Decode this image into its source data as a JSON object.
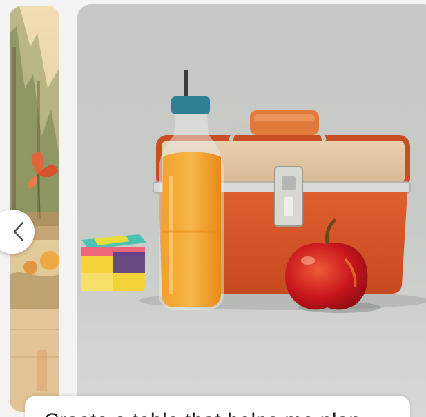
{
  "carousel": {
    "prev_icon": "chevron-left-icon",
    "left_card_alt": "watercolor forest scene",
    "main_card_alt": "lunch box with juice bottle, apple and juice box"
  },
  "caption": {
    "text": "Create a table that helps me plan"
  },
  "colors": {
    "background": "#f3f3f3",
    "card_bg": "#c6c8c5",
    "lunchbox_orange": "#d4532b",
    "lunchbox_beige": "#e3c7a4",
    "juice": "#f39a22",
    "cap": "#2f7f95",
    "apple": "#c7151c"
  }
}
